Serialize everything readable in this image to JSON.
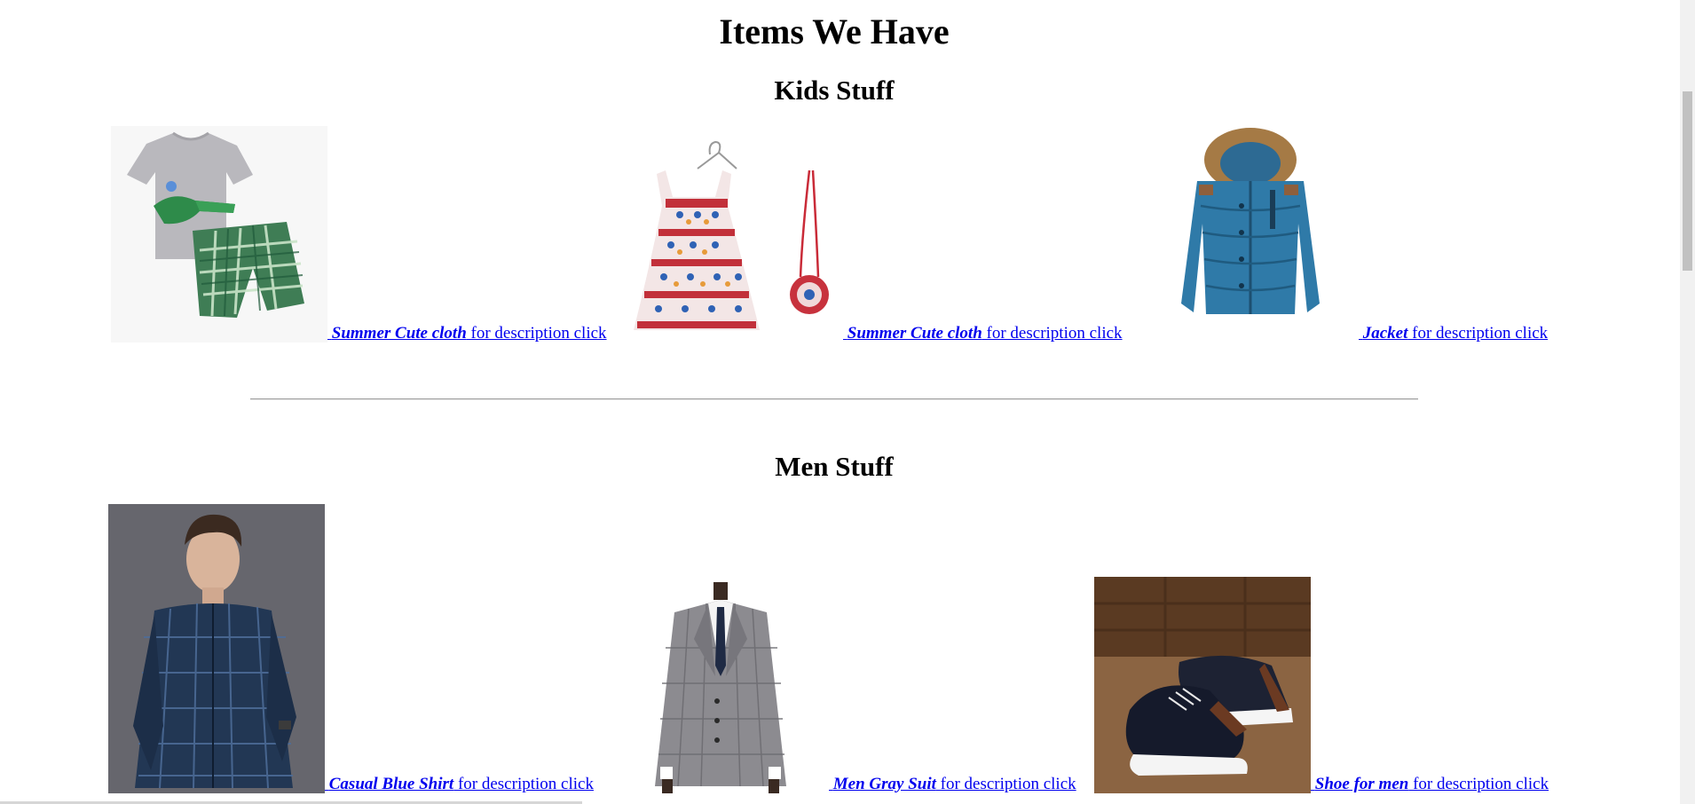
{
  "page": {
    "title": "Items We Have"
  },
  "kids": {
    "heading": "Kids Stuff",
    "items": [
      {
        "name": "Summer Cute cloth",
        "suffix": " for description click ",
        "image": "kids-tshirt-shorts-image"
      },
      {
        "name": "Summer Cute cloth",
        "suffix": " for description click ",
        "image": "kids-floral-dress-image"
      },
      {
        "name": "Jacket",
        "suffix": " for description click",
        "image": "kids-blue-jacket-image"
      }
    ]
  },
  "men": {
    "heading": "Men Stuff",
    "items": [
      {
        "name": "Casual Blue Shirt",
        "suffix": " for description click ",
        "image": "men-blue-shirt-image"
      },
      {
        "name": "Men Gray Suit",
        "suffix": " for description click ",
        "image": "men-gray-suit-image"
      },
      {
        "name": "Shoe for men",
        "suffix": " for description click",
        "image": "men-shoes-image"
      }
    ]
  },
  "colors": {
    "link": "#0000ee",
    "text": "#000000",
    "rule": "#9a9a9a"
  }
}
